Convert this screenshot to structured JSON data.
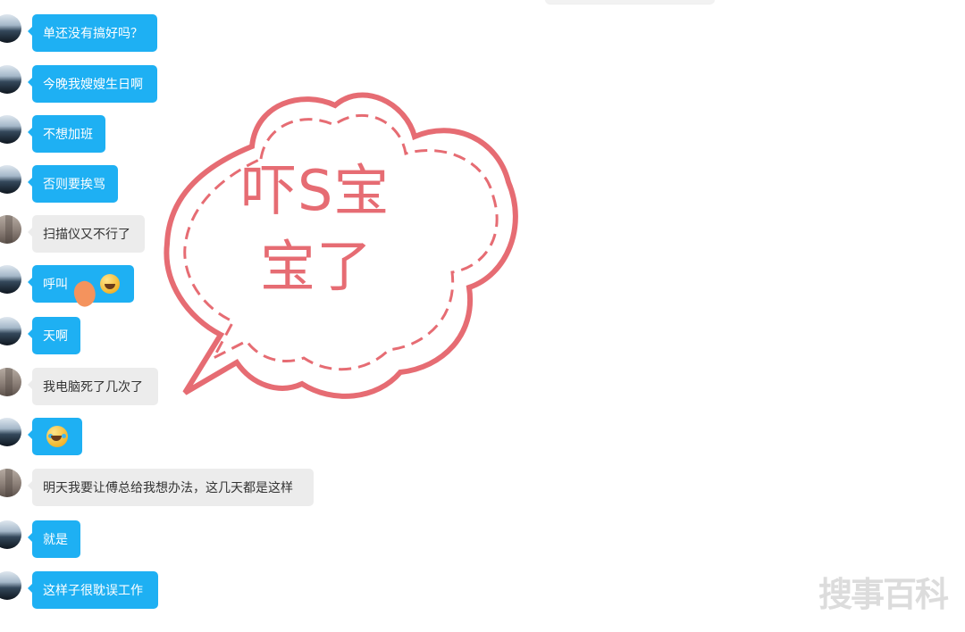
{
  "messages": [
    {
      "text": "单还没有搞好吗？",
      "style": "blue",
      "avatar": "mountain"
    },
    {
      "text": "今晚我嫂嫂生日啊",
      "style": "blue",
      "avatar": "mountain"
    },
    {
      "text": "不想加班",
      "style": "blue",
      "avatar": "mountain"
    },
    {
      "text": "否则要挨骂",
      "style": "blue",
      "avatar": "mountain"
    },
    {
      "text": "扫描仪又不行了",
      "style": "gray",
      "avatar": "building"
    },
    {
      "text": "呼叫",
      "style": "blue",
      "avatar": "mountain"
    },
    {
      "text": "天啊",
      "style": "blue",
      "avatar": "mountain"
    },
    {
      "text": "我电脑死了几次了",
      "style": "gray",
      "avatar": "building"
    },
    {
      "text": "",
      "style": "blue",
      "avatar": "mountain"
    },
    {
      "text": "明天我要让傅总给我想办法，这几天都是这样",
      "style": "gray",
      "avatar": "building"
    },
    {
      "text": "就是",
      "style": "blue",
      "avatar": "mountain"
    },
    {
      "text": "这样子很耽误工作",
      "style": "blue",
      "avatar": "mountain"
    }
  ],
  "overlay": {
    "line1": "吓S宝",
    "line2": "宝了"
  },
  "watermark": "搜事百科",
  "colors": {
    "blue_bubble": "#1eb0f3",
    "gray_bubble": "#ececec",
    "overlay_pink": "#e66c73"
  }
}
